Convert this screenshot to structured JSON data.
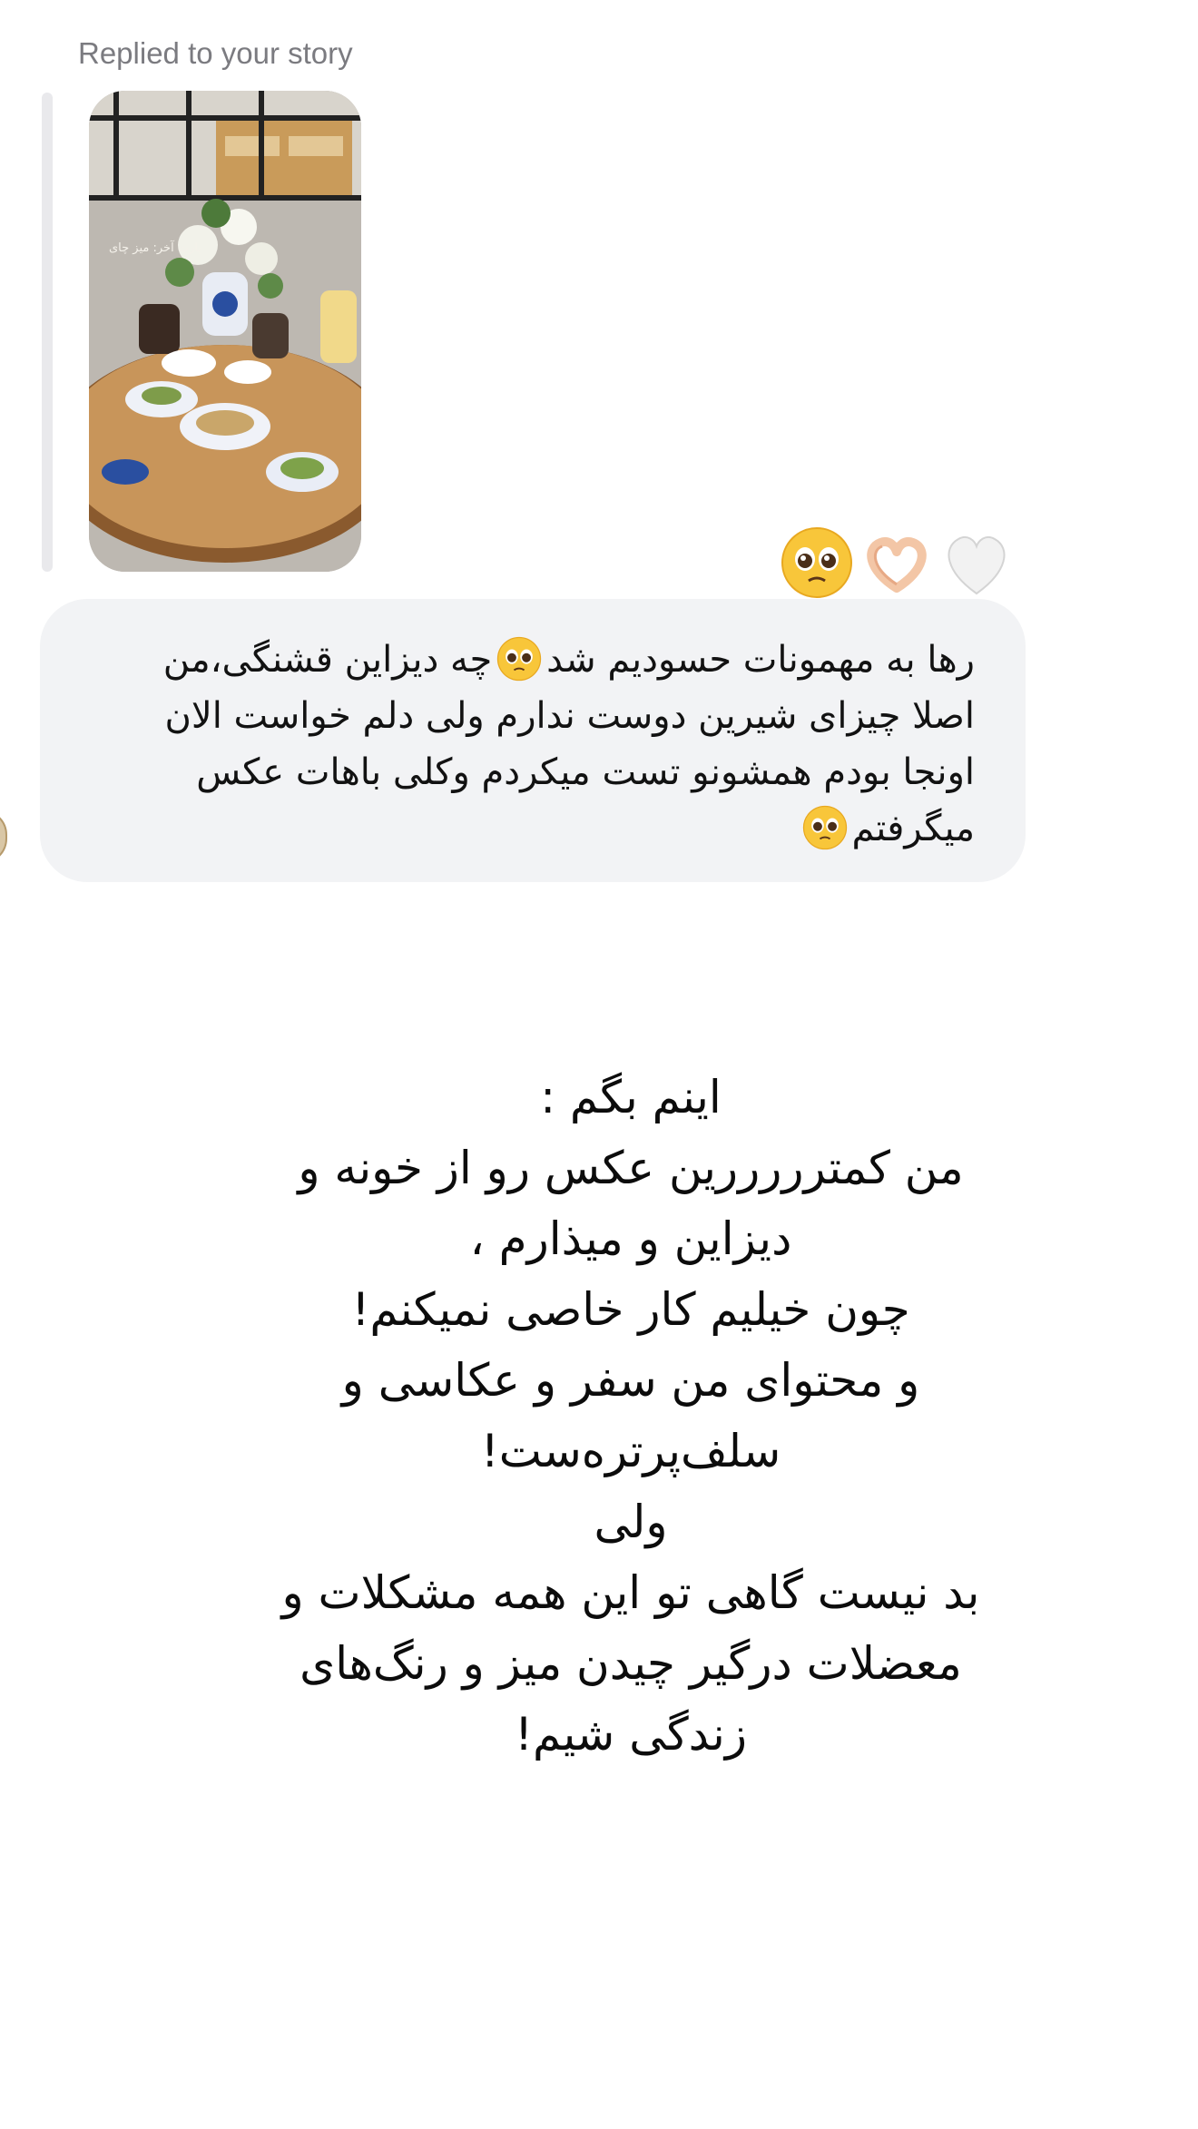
{
  "reply": {
    "label": "Replied to your story",
    "story_overlay_text": "پارت آخر: میز چای"
  },
  "reactions": [
    {
      "icon": "pleading-face-icon"
    },
    {
      "icon": "heart-hands-icon"
    },
    {
      "icon": "white-heart-icon"
    }
  ],
  "message": {
    "line1_before_emoji": "رها به مهمونات حسودیم شد",
    "line1_after_emoji": "چه دیزاین قشنگی،من",
    "line2": "اصلا چیزای شیرین دوست ندارم ولی دلم خواست الان",
    "line3": "اونجا بودم همشونو تست میکردم وکلی باهات عکس",
    "line4": "میگرفتم",
    "emoji": "pleading-face-icon"
  },
  "story_caption": {
    "lines": [
      "اینم بگم :",
      "من کمترررررین عکس رو از خونه و",
      "دیزاین و میذارم ،",
      "چون خیلیم کار خاصی نمیکنم!",
      "و محتوای من سفر و عکاسی و",
      "سلف‌پرترەست!",
      "ولی",
      "بد نیست گاهی تو این همه مشکلات و",
      "معضلات درگیر چیدن میز و رنگ‌های",
      "زندگی شیم!"
    ]
  },
  "colors": {
    "bubble_bg": "#f2f3f5",
    "label_gray": "#7b7b80",
    "reply_bar": "#e9e9ec",
    "text": "#111111"
  }
}
